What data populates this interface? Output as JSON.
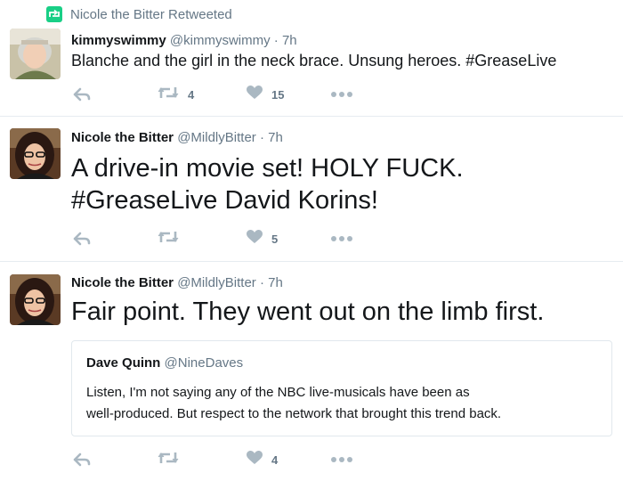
{
  "retweet_banner": {
    "text": "Nicole the Bitter Retweeted",
    "icon": "retweet-icon",
    "color": "#19cf86"
  },
  "tweets": [
    {
      "fullname": "kimmyswimmy",
      "handle": "@kimmyswimmy",
      "separator": "·",
      "time": "7h",
      "text_lines": [
        "Blanche and the girl in the neck brace.  Unsung heroes.  #GreaseLive"
      ],
      "actions": {
        "reply_icon": "reply-icon",
        "retweet_icon": "retweet-icon",
        "retweet_count": "4",
        "like_icon": "heart-icon",
        "like_count": "15",
        "more_icon": "more-icon"
      }
    },
    {
      "fullname": "Nicole the Bitter",
      "handle": "@MildlyBitter",
      "separator": "·",
      "time": "7h",
      "text_lines": [
        "A drive-in movie set! HOLY FUCK.",
        "#GreaseLive  David Korins!"
      ],
      "actions": {
        "reply_icon": "reply-icon",
        "retweet_icon": "retweet-icon",
        "retweet_count": "",
        "like_icon": "heart-icon",
        "like_count": "5",
        "more_icon": "more-icon"
      }
    },
    {
      "fullname": "Nicole the Bitter",
      "handle": "@MildlyBitter",
      "separator": "·",
      "time": "7h",
      "text_lines": [
        "Fair point. They went out on the limb first."
      ],
      "quoted": {
        "fullname": "Dave Quinn",
        "handle": "@NineDaves",
        "text_lines": [
          "Listen, I'm not saying any of the NBC live-musicals have been as",
          "well-produced. But respect to the network that brought this trend back."
        ]
      },
      "actions": {
        "reply_icon": "reply-icon",
        "retweet_icon": "retweet-icon",
        "retweet_count": "",
        "like_icon": "heart-icon",
        "like_count": "4",
        "more_icon": "more-icon"
      }
    }
  ],
  "colors": {
    "action_gray": "#aab8c2",
    "text_secondary": "#657786",
    "divider": "#e6ecf0"
  }
}
